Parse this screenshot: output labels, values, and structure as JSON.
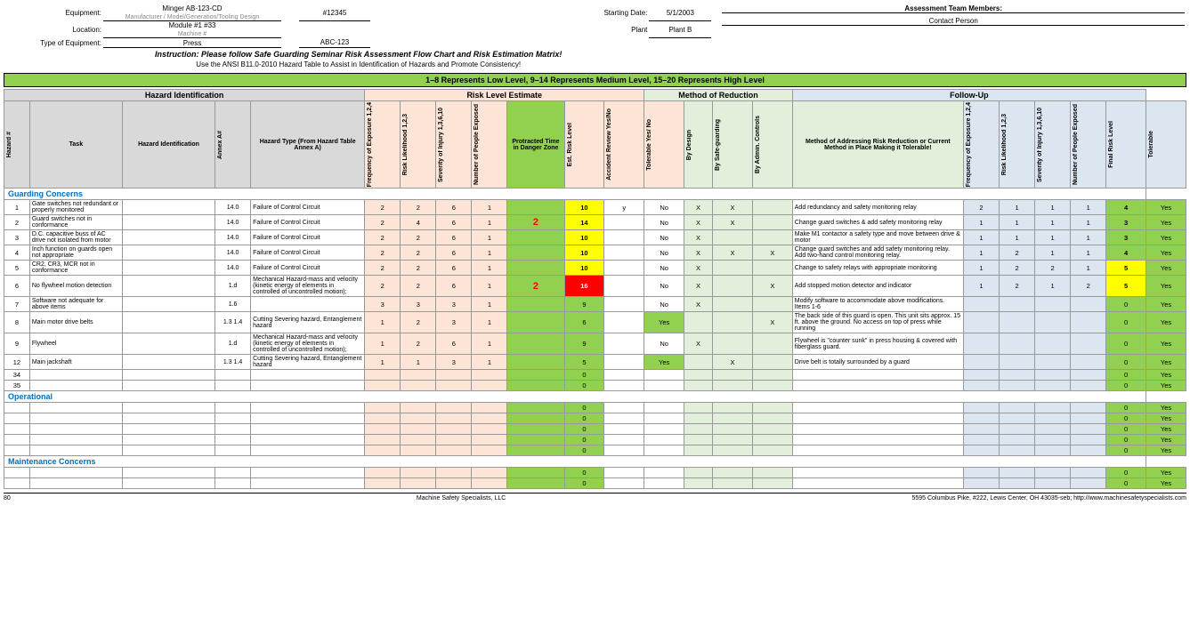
{
  "header": {
    "equipment_label": "Equipment:",
    "equipment_value": "Minger AB-123-CD",
    "equipment_sub": "Manufacturer / Model/Generation/Tooling Design",
    "location_label": "Location:",
    "location_value": "Module #1  #33",
    "location_sub": "Machine #",
    "id_value": "#12345",
    "starting_date_label": "Starting Date:",
    "starting_date_value": "5/1/2003",
    "type_label": "Type of Equipment:",
    "type_value": "Press",
    "equipment_id_value": "ABC-123",
    "plant_label": "Plant",
    "plant_value": "Plant B",
    "assessment_team_label": "Assessment Team Members:",
    "contact_label": "Contact Person",
    "instruction1": "Instruction: Please follow Safe Guarding Seminar Risk Assessment Flow Chart and Risk Estimation Matrix!",
    "instruction2": "Use the ANSI B11.0-2010 Hazard Table to Assist in Identification of Hazards and Promote Consistency!"
  },
  "risk_level_header": "1–8 Represents Low Level,      9–14 Represents Medium Level,      15–20 Represents High Level",
  "columns": {
    "hazard_id": "Hazard Identification",
    "risk_estimate": "Risk Level Estimate",
    "method_reduction": "Method of Reduction",
    "followup": "Follow-Up"
  },
  "sub_columns": {
    "hazard_num": "#",
    "task": "Task",
    "hazard_identification": "Hazard Identification",
    "annex_a": "Annex A#",
    "hazard_type": "Hazard Type (From Hazard Table Annex A)",
    "freq_exposure": "Frequency of Exposure 1,2,4",
    "risk_likelihood": "Risk Likelihood 1,2,3",
    "severity_injury": "Severity of Injury 1,3,6,10",
    "num_people": "Number of People Exposed",
    "protracted_time": "Protracted Time in Danger Zone",
    "est_risk": "Est. Risk Level",
    "accident_review": "Accident Review Yes/No",
    "tolerable": "Tolerable Yes/ No",
    "by_design": "By Design",
    "by_safeguarding": "By Safe-guarding",
    "by_admin": "By Admin. Controls",
    "method_addressing": "Method of Addressing Risk Reduction or Current Method in Place Making it Tolerable!",
    "freq_exposure2": "Frequency of Exposure 1,2,4",
    "risk_likelihood2": "Risk Likelihood 1,2,3",
    "severity_injury2": "Severity of Injury 1,3,6,10",
    "num_people2": "Number of People Exposed",
    "final_risk": "Final Risk Level",
    "tolerable2": "Tolerable"
  },
  "sections": [
    {
      "name": "Guarding Concerns",
      "color": "#0070c0",
      "rows": [
        {
          "num": "1",
          "task": "Gate switches not redundant or properly monitored",
          "annex_a": "14.0",
          "hazard_type": "Failure of Control Circuit",
          "freq": "2",
          "likelihood": "2",
          "severity": "6",
          "num_people": "1",
          "protracted": "",
          "risk_level": "10",
          "risk_class": "risk-10",
          "accident": "y",
          "tolerable": "No",
          "by_design": "X",
          "by_safeguard": "X",
          "by_admin": "",
          "method": "Add redundancy and safety monitoring relay",
          "freq2": "2",
          "likelihood2": "1",
          "severity2": "1",
          "num_people2": "1",
          "final_risk": "4",
          "final_class": "final-4",
          "tolerable2": "Yes",
          "tolerable2_class": "yes-cell"
        },
        {
          "num": "2",
          "task": "Guard switches not in conformance",
          "annex_a": "14.0",
          "hazard_type": "Failure of Control Circuit",
          "freq": "2",
          "likelihood": "4",
          "severity": "6",
          "num_people": "1",
          "protracted": "2",
          "risk_level": "14",
          "risk_class": "risk-14",
          "accident": "",
          "tolerable": "No",
          "by_design": "X",
          "by_safeguard": "X",
          "by_admin": "",
          "method": "Change guard switches & add safety monitoring relay",
          "freq2": "1",
          "likelihood2": "1",
          "severity2": "1",
          "num_people2": "1",
          "final_risk": "3",
          "final_class": "final-3",
          "tolerable2": "Yes",
          "tolerable2_class": "yes-cell"
        },
        {
          "num": "3",
          "task": "D.C. capacitive buss of AC drive not isolated from motor",
          "annex_a": "14.0",
          "hazard_type": "Failure of Control Circuit",
          "freq": "2",
          "likelihood": "2",
          "severity": "6",
          "num_people": "1",
          "protracted": "",
          "risk_level": "10",
          "risk_class": "risk-10",
          "accident": "",
          "tolerable": "No",
          "by_design": "X",
          "by_safeguard": "",
          "by_admin": "",
          "method": "Make M1 contactor a safety type and move between drive & motor",
          "freq2": "1",
          "likelihood2": "1",
          "severity2": "1",
          "num_people2": "1",
          "final_risk": "3",
          "final_class": "final-3",
          "tolerable2": "Yes",
          "tolerable2_class": "yes-cell"
        },
        {
          "num": "4",
          "task": "Inch function on guards open not appropriate",
          "annex_a": "14.0",
          "hazard_type": "Failure of Control Circuit",
          "freq": "2",
          "likelihood": "2",
          "severity": "6",
          "num_people": "1",
          "protracted": "",
          "risk_level": "10",
          "risk_class": "risk-10",
          "accident": "",
          "tolerable": "No",
          "by_design": "X",
          "by_safeguard": "X",
          "by_admin": "X",
          "method": "Change guard switches and add safety monitoring relay. Add two-hand control monitoring relay.",
          "freq2": "1",
          "likelihood2": "2",
          "severity2": "1",
          "num_people2": "1",
          "final_risk": "4",
          "final_class": "final-4",
          "tolerable2": "Yes",
          "tolerable2_class": "yes-cell"
        },
        {
          "num": "5",
          "task": "CR2, CR3, MCR not in conformance",
          "annex_a": "14.0",
          "hazard_type": "Failure of Control Circuit",
          "freq": "2",
          "likelihood": "2",
          "severity": "6",
          "num_people": "1",
          "protracted": "",
          "risk_level": "10",
          "risk_class": "risk-10",
          "accident": "",
          "tolerable": "No",
          "by_design": "X",
          "by_safeguard": "",
          "by_admin": "",
          "method": "Change to safety relays with appropriate monitoring",
          "freq2": "1",
          "likelihood2": "2",
          "severity2": "2",
          "num_people2": "1",
          "final_risk": "5",
          "final_class": "final-5",
          "tolerable2": "Yes",
          "tolerable2_class": "yes-cell"
        },
        {
          "num": "6",
          "task": "No flywheel motion detection",
          "annex_a": "1.d",
          "hazard_type": "Mechanical Hazard-mass and velocity (kinetic energy of elements in controlled of uncontrolled motion);",
          "freq": "2",
          "likelihood": "2",
          "severity": "6",
          "num_people": "1",
          "protracted": "2",
          "risk_level": "16",
          "risk_class": "risk-16",
          "accident": "",
          "tolerable": "No",
          "by_design": "X",
          "by_safeguard": "",
          "by_admin": "X",
          "method": "Add stopped motion detector and indicator",
          "freq2": "1",
          "likelihood2": "2",
          "severity2": "1",
          "num_people2": "2",
          "final_risk": "5",
          "final_class": "final-5",
          "tolerable2": "Yes",
          "tolerable2_class": "yes-cell"
        },
        {
          "num": "7",
          "task": "Software not adequate for above items",
          "annex_a": "1.6",
          "hazard_type": "",
          "freq": "3",
          "likelihood": "3",
          "severity": "3",
          "num_people": "1",
          "protracted": "",
          "risk_level": "9",
          "risk_class": "risk-9",
          "accident": "",
          "tolerable": "No",
          "by_design": "X",
          "by_safeguard": "",
          "by_admin": "",
          "method": "Modify software to accommodate above modifications. Items 1-6",
          "freq2": "",
          "likelihood2": "",
          "severity2": "",
          "num_people2": "",
          "final_risk": "0",
          "final_class": "final-0",
          "tolerable2": "Yes",
          "tolerable2_class": "yes-cell"
        },
        {
          "num": "8",
          "task": "Main motor drive belts",
          "annex_a": "1.3 1.4",
          "hazard_type": "Cutting Severing hazard, Entanglement hazard",
          "freq": "1",
          "likelihood": "2",
          "severity": "3",
          "num_people": "1",
          "protracted": "",
          "risk_level": "6",
          "risk_class": "risk-6",
          "accident": "",
          "tolerable": "Yes",
          "by_design": "",
          "by_safeguard": "",
          "by_admin": "X",
          "method": "The back side of this guard is open. This unit sits approx. 15 ft. above the ground. No access on top of press while running",
          "freq2": "",
          "likelihood2": "",
          "severity2": "",
          "num_people2": "",
          "final_risk": "0",
          "final_class": "final-0",
          "tolerable2": "Yes",
          "tolerable2_class": "yes-cell"
        },
        {
          "num": "9",
          "task": "Flywheel",
          "annex_a": "1.d",
          "hazard_type": "Mechanical Hazard-mass and velocity (kinetic energy of elements in controlled of uncontrolled motion);",
          "freq": "1",
          "likelihood": "2",
          "severity": "6",
          "num_people": "1",
          "protracted": "",
          "risk_level": "9",
          "risk_class": "risk-9",
          "accident": "",
          "tolerable": "No",
          "by_design": "X",
          "by_safeguard": "",
          "by_admin": "",
          "method": "Flywheel is \"counter sunk\" in press housing & covered with fiberglass guard.",
          "freq2": "",
          "likelihood2": "",
          "severity2": "",
          "num_people2": "",
          "final_risk": "0",
          "final_class": "final-0",
          "tolerable2": "Yes",
          "tolerable2_class": "yes-cell"
        },
        {
          "num": "12",
          "task": "Main jackshaft",
          "annex_a": "1.3 1.4",
          "hazard_type": "Cutting Severing hazard, Entanglement hazard",
          "freq": "1",
          "likelihood": "1",
          "severity": "3",
          "num_people": "1",
          "protracted": "",
          "risk_level": "5",
          "risk_class": "risk-5",
          "accident": "",
          "tolerable": "Yes",
          "by_design": "",
          "by_safeguard": "X",
          "by_admin": "",
          "method": "Drive belt is totally surrounded by a guard",
          "freq2": "",
          "likelihood2": "",
          "severity2": "",
          "num_people2": "",
          "final_risk": "0",
          "final_class": "final-0",
          "tolerable2": "Yes",
          "tolerable2_class": "yes-cell"
        },
        {
          "num": "34",
          "task": "",
          "annex_a": "",
          "hazard_type": "",
          "freq": "",
          "likelihood": "",
          "severity": "",
          "num_people": "",
          "protracted": "",
          "risk_level": "0",
          "risk_class": "risk-0",
          "accident": "",
          "tolerable": "",
          "by_design": "",
          "by_safeguard": "",
          "by_admin": "",
          "method": "",
          "freq2": "",
          "likelihood2": "",
          "severity2": "",
          "num_people2": "",
          "final_risk": "0",
          "final_class": "final-0",
          "tolerable2": "Yes",
          "tolerable2_class": "yes-cell"
        },
        {
          "num": "35",
          "task": "",
          "annex_a": "",
          "hazard_type": "",
          "freq": "",
          "likelihood": "",
          "severity": "",
          "num_people": "",
          "protracted": "",
          "risk_level": "0",
          "risk_class": "risk-0",
          "accident": "",
          "tolerable": "",
          "by_design": "",
          "by_safeguard": "",
          "by_admin": "",
          "method": "",
          "freq2": "",
          "likelihood2": "",
          "severity2": "",
          "num_people2": "",
          "final_risk": "0",
          "final_class": "final-0",
          "tolerable2": "Yes",
          "tolerable2_class": "yes-cell"
        }
      ]
    },
    {
      "name": "Operational",
      "color": "#0070c0",
      "rows": [
        {
          "num": "",
          "task": "",
          "annex_a": "",
          "hazard_type": "",
          "freq": "",
          "likelihood": "",
          "severity": "",
          "num_people": "",
          "protracted": "",
          "risk_level": "0",
          "risk_class": "risk-0",
          "accident": "",
          "tolerable": "",
          "by_design": "",
          "by_safeguard": "",
          "by_admin": "",
          "method": "",
          "freq2": "",
          "likelihood2": "",
          "severity2": "",
          "num_people2": "",
          "final_risk": "0",
          "final_class": "final-0",
          "tolerable2": "Yes",
          "tolerable2_class": "yes-cell"
        },
        {
          "num": "",
          "task": "",
          "annex_a": "",
          "hazard_type": "",
          "freq": "",
          "likelihood": "",
          "severity": "",
          "num_people": "",
          "protracted": "",
          "risk_level": "0",
          "risk_class": "risk-0",
          "accident": "",
          "tolerable": "",
          "by_design": "",
          "by_safeguard": "",
          "by_admin": "",
          "method": "",
          "freq2": "",
          "likelihood2": "",
          "severity2": "",
          "num_people2": "",
          "final_risk": "0",
          "final_class": "final-0",
          "tolerable2": "Yes",
          "tolerable2_class": "yes-cell"
        },
        {
          "num": "",
          "task": "",
          "annex_a": "",
          "hazard_type": "",
          "freq": "",
          "likelihood": "",
          "severity": "",
          "num_people": "",
          "protracted": "",
          "risk_level": "0",
          "risk_class": "risk-0",
          "accident": "",
          "tolerable": "",
          "by_design": "",
          "by_safeguard": "",
          "by_admin": "",
          "method": "",
          "freq2": "",
          "likelihood2": "",
          "severity2": "",
          "num_people2": "",
          "final_risk": "0",
          "final_class": "final-0",
          "tolerable2": "Yes",
          "tolerable2_class": "yes-cell"
        },
        {
          "num": "",
          "task": "",
          "annex_a": "",
          "hazard_type": "",
          "freq": "",
          "likelihood": "",
          "severity": "",
          "num_people": "",
          "protracted": "",
          "risk_level": "0",
          "risk_class": "risk-0",
          "accident": "",
          "tolerable": "",
          "by_design": "",
          "by_safeguard": "",
          "by_admin": "",
          "method": "",
          "freq2": "",
          "likelihood2": "",
          "severity2": "",
          "num_people2": "",
          "final_risk": "0",
          "final_class": "final-0",
          "tolerable2": "Yes",
          "tolerable2_class": "yes-cell"
        },
        {
          "num": "",
          "task": "",
          "annex_a": "",
          "hazard_type": "",
          "freq": "",
          "likelihood": "",
          "severity": "",
          "num_people": "",
          "protracted": "",
          "risk_level": "0",
          "risk_class": "risk-0",
          "accident": "",
          "tolerable": "",
          "by_design": "",
          "by_safeguard": "",
          "by_admin": "",
          "method": "",
          "freq2": "",
          "likelihood2": "",
          "severity2": "",
          "num_people2": "",
          "final_risk": "0",
          "final_class": "final-0",
          "tolerable2": "Yes",
          "tolerable2_class": "yes-cell"
        }
      ]
    },
    {
      "name": "Maintenance Concerns",
      "color": "#0070c0",
      "rows": [
        {
          "num": "",
          "task": "",
          "annex_a": "",
          "hazard_type": "",
          "freq": "",
          "likelihood": "",
          "severity": "",
          "num_people": "",
          "protracted": "",
          "risk_level": "0",
          "risk_class": "risk-0",
          "accident": "",
          "tolerable": "",
          "by_design": "",
          "by_safeguard": "",
          "by_admin": "",
          "method": "",
          "freq2": "",
          "likelihood2": "",
          "severity2": "",
          "num_people2": "",
          "final_risk": "0",
          "final_class": "final-0",
          "tolerable2": "Yes",
          "tolerable2_class": "yes-cell"
        },
        {
          "num": "",
          "task": "",
          "annex_a": "",
          "hazard_type": "",
          "freq": "",
          "likelihood": "",
          "severity": "",
          "num_people": "",
          "protracted": "",
          "risk_level": "0",
          "risk_class": "risk-0",
          "accident": "",
          "tolerable": "",
          "by_design": "",
          "by_safeguard": "",
          "by_admin": "",
          "method": "",
          "freq2": "",
          "likelihood2": "",
          "severity2": "",
          "num_people2": "",
          "final_risk": "0",
          "final_class": "final-0",
          "tolerable2": "Yes",
          "tolerable2_class": "yes-cell"
        }
      ]
    }
  ],
  "footer": {
    "page_num": "80",
    "company": "Machine Safety Specialists, LLC",
    "address": "5595 Columbus Pike, #222, Lewis Center, OH 43035-seb; http://www.machinesafetyspecialists.com"
  }
}
